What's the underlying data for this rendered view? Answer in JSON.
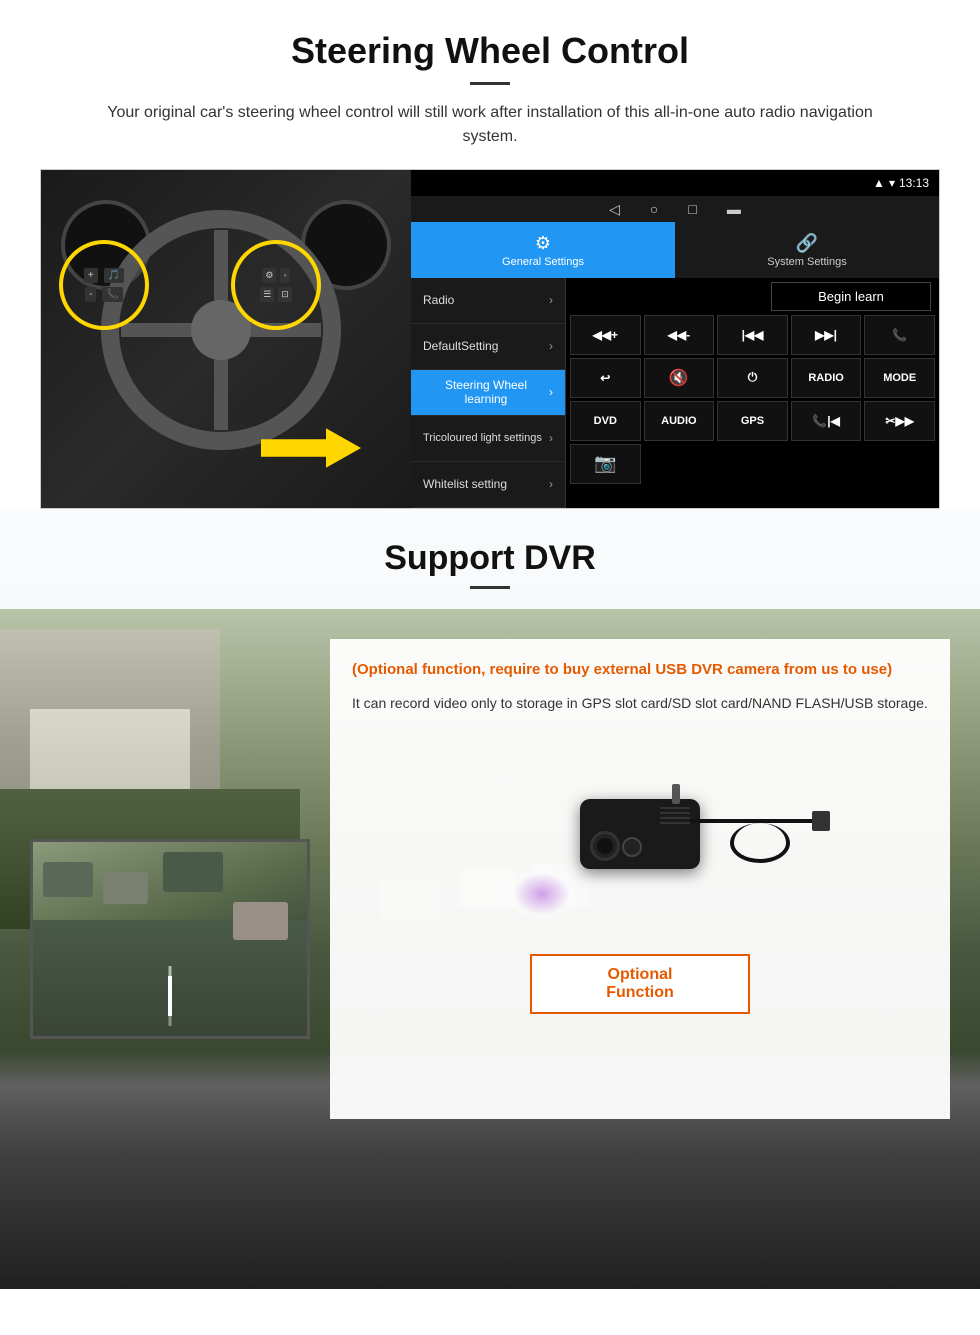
{
  "section1": {
    "title": "Steering Wheel Control",
    "description": "Your original car's steering wheel control will still work after installation of this all-in-one auto radio navigation system.",
    "android_statusbar": {
      "time": "13:13",
      "icons": [
        "signal",
        "wifi",
        "battery"
      ]
    },
    "tabs": {
      "general": {
        "label": "General Settings",
        "icon": "⚙"
      },
      "system": {
        "label": "System Settings",
        "icon": "🔗"
      }
    },
    "menu_items": [
      {
        "label": "Radio",
        "active": false
      },
      {
        "label": "DefaultSetting",
        "active": false
      },
      {
        "label": "Steering Wheel learning",
        "active": true
      },
      {
        "label": "Tricoloured light settings",
        "active": false
      },
      {
        "label": "Whitelist setting",
        "active": false
      }
    ],
    "begin_learn": "Begin learn",
    "control_buttons": [
      {
        "label": "◀◀+",
        "row": 1
      },
      {
        "label": "◀◀-",
        "row": 1
      },
      {
        "label": "|◀◀",
        "row": 1
      },
      {
        "label": "▶▶|",
        "row": 1
      },
      {
        "label": "📞",
        "row": 1
      },
      {
        "label": "↩",
        "row": 2
      },
      {
        "label": "🔇×",
        "row": 2
      },
      {
        "label": "⏻",
        "row": 2
      },
      {
        "label": "RADIO",
        "row": 2
      },
      {
        "label": "MODE",
        "row": 2
      },
      {
        "label": "DVD",
        "row": 3
      },
      {
        "label": "AUDIO",
        "row": 3
      },
      {
        "label": "GPS",
        "row": 3
      },
      {
        "label": "📞|◀◀",
        "row": 3
      },
      {
        "label": "✂▶▶|",
        "row": 3
      },
      {
        "label": "📷",
        "row": 4
      }
    ]
  },
  "section2": {
    "title": "Support DVR",
    "optional_title": "(Optional function, require to buy external USB DVR camera from us to use)",
    "description": "It can record video only to storage in GPS slot card/SD slot card/NAND FLASH/USB storage.",
    "optional_function_btn": "Optional Function"
  }
}
